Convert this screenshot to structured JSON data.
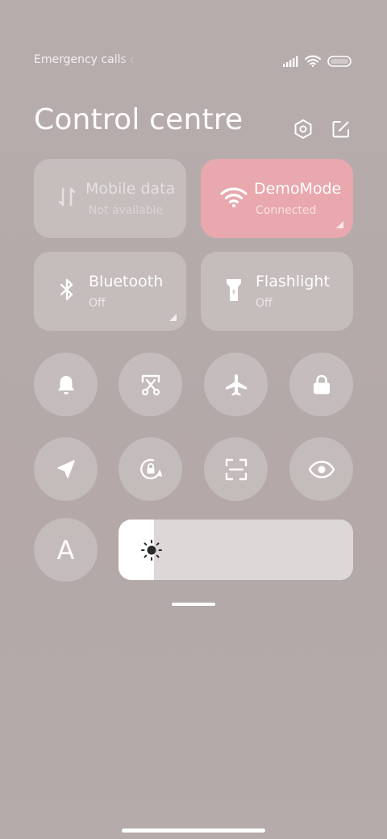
{
  "status_bar": {
    "carrier_text": "Emergency calls o",
    "icons": [
      "signal-icon",
      "wifi-icon",
      "battery-icon"
    ]
  },
  "header": {
    "title": "Control centre",
    "icons": [
      "settings-icon",
      "edit-icon"
    ]
  },
  "tiles": [
    {
      "name": "mobile-data",
      "label": "Mobile data",
      "status": "Not available",
      "icon": "mobile-data-icon",
      "active": false
    },
    {
      "name": "wifi",
      "label": "DemoMode",
      "status": "Connected",
      "icon": "wifi-icon",
      "active": true
    },
    {
      "name": "bluetooth",
      "label": "Bluetooth",
      "status": "Off",
      "icon": "bluetooth-icon",
      "active": false
    },
    {
      "name": "flashlight",
      "label": "Flashlight",
      "status": "Off",
      "icon": "flashlight-icon",
      "active": false
    }
  ],
  "toggles_row1": [
    "bell-icon",
    "screenshot-icon",
    "airplane-icon",
    "lock-icon"
  ],
  "toggles_row2": [
    "location-icon",
    "rotation-lock-icon",
    "scan-icon",
    "eye-icon"
  ],
  "auto_brightness_glyph": "A",
  "brightness": {
    "icon": "brightness-icon",
    "level": 0.15
  },
  "colors": {
    "active_tile": "#e8a8ad",
    "background": "#b6abab"
  }
}
